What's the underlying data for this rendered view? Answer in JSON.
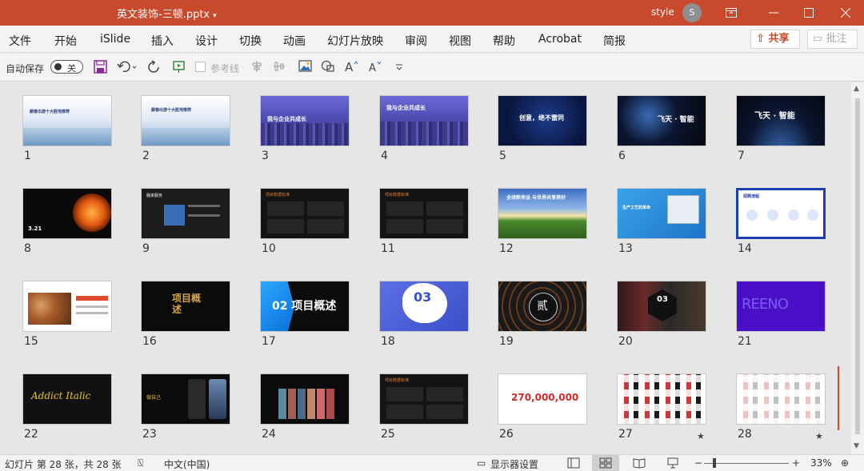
{
  "titlebar": {
    "doc_title": "英文装饰-三顿.pptx",
    "user_name": "style",
    "avatar_initial": "S",
    "accent_color": "#c9492c"
  },
  "menu": {
    "items": [
      "文件",
      "开始",
      "iSlide",
      "插入",
      "设计",
      "切换",
      "动画",
      "幻灯片放映",
      "审阅",
      "视图",
      "帮助",
      "Acrobat",
      "简报"
    ],
    "share_label": "共享",
    "comment_label": "批注"
  },
  "qat": {
    "autosave_label": "自动保存",
    "autosave_state": "关",
    "guides_label": "参考线"
  },
  "slides": [
    {
      "num": "1",
      "thumb_text": "颠春出游十大胜地推荐"
    },
    {
      "num": "2",
      "thumb_text": "颠春出游十大胜地推荐"
    },
    {
      "num": "3",
      "thumb_text": "我与企业共成长"
    },
    {
      "num": "4",
      "thumb_text": "我与企业共成长"
    },
    {
      "num": "5",
      "thumb_text": "创意，绝不雷同"
    },
    {
      "num": "6",
      "thumb_text": "飞天 · 智能"
    },
    {
      "num": "7",
      "thumb_text": "飞天 · 智能"
    },
    {
      "num": "8",
      "thumb_text": "3.21"
    },
    {
      "num": "9",
      "thumb_text": "融资服务"
    },
    {
      "num": "10",
      "thumb_text": "项目数据标准"
    },
    {
      "num": "11",
      "thumb_text": "项目数据标准"
    },
    {
      "num": "12",
      "thumb_text": "全球新命运 与世界共享美好"
    },
    {
      "num": "13",
      "thumb_text": "生产工艺的革命"
    },
    {
      "num": "14",
      "thumb_text": "招聘流程"
    },
    {
      "num": "15",
      "thumb_text": ""
    },
    {
      "num": "16",
      "thumb_text": "项目概述"
    },
    {
      "num": "17",
      "thumb_text": "02 项目概述"
    },
    {
      "num": "18",
      "thumb_text": "03"
    },
    {
      "num": "19",
      "thumb_text": "贰"
    },
    {
      "num": "20",
      "thumb_text": "03"
    },
    {
      "num": "21",
      "thumb_text": "REENO"
    },
    {
      "num": "22",
      "thumb_text": "Addict Italic"
    },
    {
      "num": "23",
      "thumb_text": "做自己"
    },
    {
      "num": "24",
      "thumb_text": ""
    },
    {
      "num": "25",
      "thumb_text": "项目数据标准"
    },
    {
      "num": "26",
      "thumb_text": "270,000,000"
    },
    {
      "num": "27",
      "thumb_text": ""
    },
    {
      "num": "28",
      "thumb_text": ""
    }
  ],
  "star_glyph": "★",
  "status": {
    "slide_info": "幻灯片 第 28 张，共 28 张",
    "language": "中文(中国)",
    "display_settings": "显示器设置",
    "zoom_level": "33%"
  }
}
